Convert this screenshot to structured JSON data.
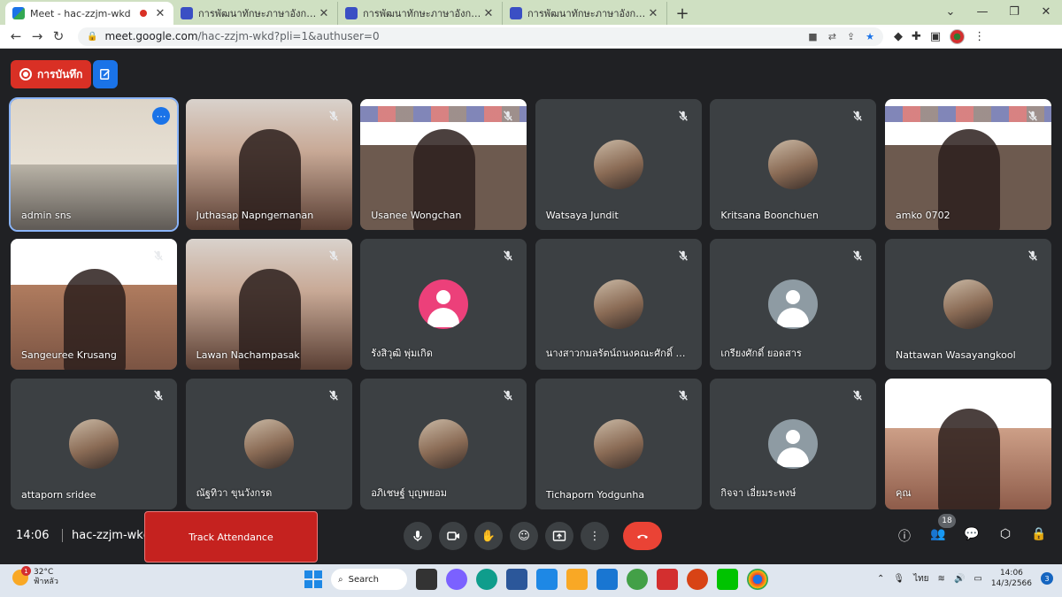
{
  "browser": {
    "tabs": [
      {
        "title": "Meet - hac-zzjm-wkd",
        "active": true,
        "icon": "meet-icon"
      },
      {
        "title": "การพัฒนาทักษะภาษาอังกฤษ English",
        "active": false,
        "icon": "docs-icon"
      },
      {
        "title": "การพัฒนาทักษะภาษาอังกฤษ English",
        "active": false,
        "icon": "docs-icon"
      },
      {
        "title": "การพัฒนาทักษะภาษาอังกฤษ English",
        "active": false,
        "icon": "docs-icon"
      }
    ],
    "url_host": "meet.google.com",
    "url_path": "/hac-zzjm-wkd?pli=1&authuser=0"
  },
  "meet": {
    "recording_label": "การบันทึก",
    "participants": [
      {
        "name": "admin sns",
        "type": "video-room",
        "muted": false
      },
      {
        "name": "Juthasap Napngernanan",
        "type": "video-person",
        "muted": true
      },
      {
        "name": "Usanee Wongchan",
        "type": "video-slide",
        "muted": true
      },
      {
        "name": "Watsaya Jundit",
        "type": "avatar-photo",
        "muted": true
      },
      {
        "name": "Kritsana Boonchuen",
        "type": "avatar-photo",
        "muted": true
      },
      {
        "name": "amko 0702",
        "type": "video-slide",
        "muted": true
      },
      {
        "name": "Sangeuree Krusang",
        "type": "video-slide2",
        "muted": true
      },
      {
        "name": "Lawan Nachampasak",
        "type": "video-person",
        "muted": true
      },
      {
        "name": "รังสิวุฒิ พุ่มเกิด",
        "type": "avatar-pink",
        "muted": true
      },
      {
        "name": "นางสาวกมลรัตน์ถนงคณะศักดิ์ -๑...",
        "type": "avatar-photo",
        "muted": true
      },
      {
        "name": "เกรียงศักดิ์ ยอดสาร",
        "type": "avatar-grey",
        "muted": true
      },
      {
        "name": "Nattawan Wasayangkool",
        "type": "avatar-photo",
        "muted": true
      },
      {
        "name": "attaporn sridee",
        "type": "avatar-photo",
        "muted": true
      },
      {
        "name": "ณัฐทิวา ขุนวังกรด",
        "type": "avatar-photo",
        "muted": true
      },
      {
        "name": "อภิเชษฐ์ บุญพยอม",
        "type": "avatar-photo",
        "muted": true
      },
      {
        "name": "Tichaporn Yodgunha",
        "type": "avatar-photo",
        "muted": true
      },
      {
        "name": "กิจจา เอี่ยมระหงษ์",
        "type": "avatar-grey",
        "muted": true
      },
      {
        "name": "คุณ",
        "type": "video-self",
        "muted": false
      }
    ],
    "clock": "14:06",
    "meeting_code": "hac-zzjm-wkd",
    "track_attendance_label": "Track Attendance",
    "participant_count": "18"
  },
  "taskbar": {
    "weather_temp": "32°C",
    "weather_desc": "ฟ้าหลัว",
    "weather_badge": "1",
    "search_label": "Search",
    "language": "ไทย",
    "time": "14:06",
    "date": "14/3/2566",
    "notification_count": "3"
  }
}
